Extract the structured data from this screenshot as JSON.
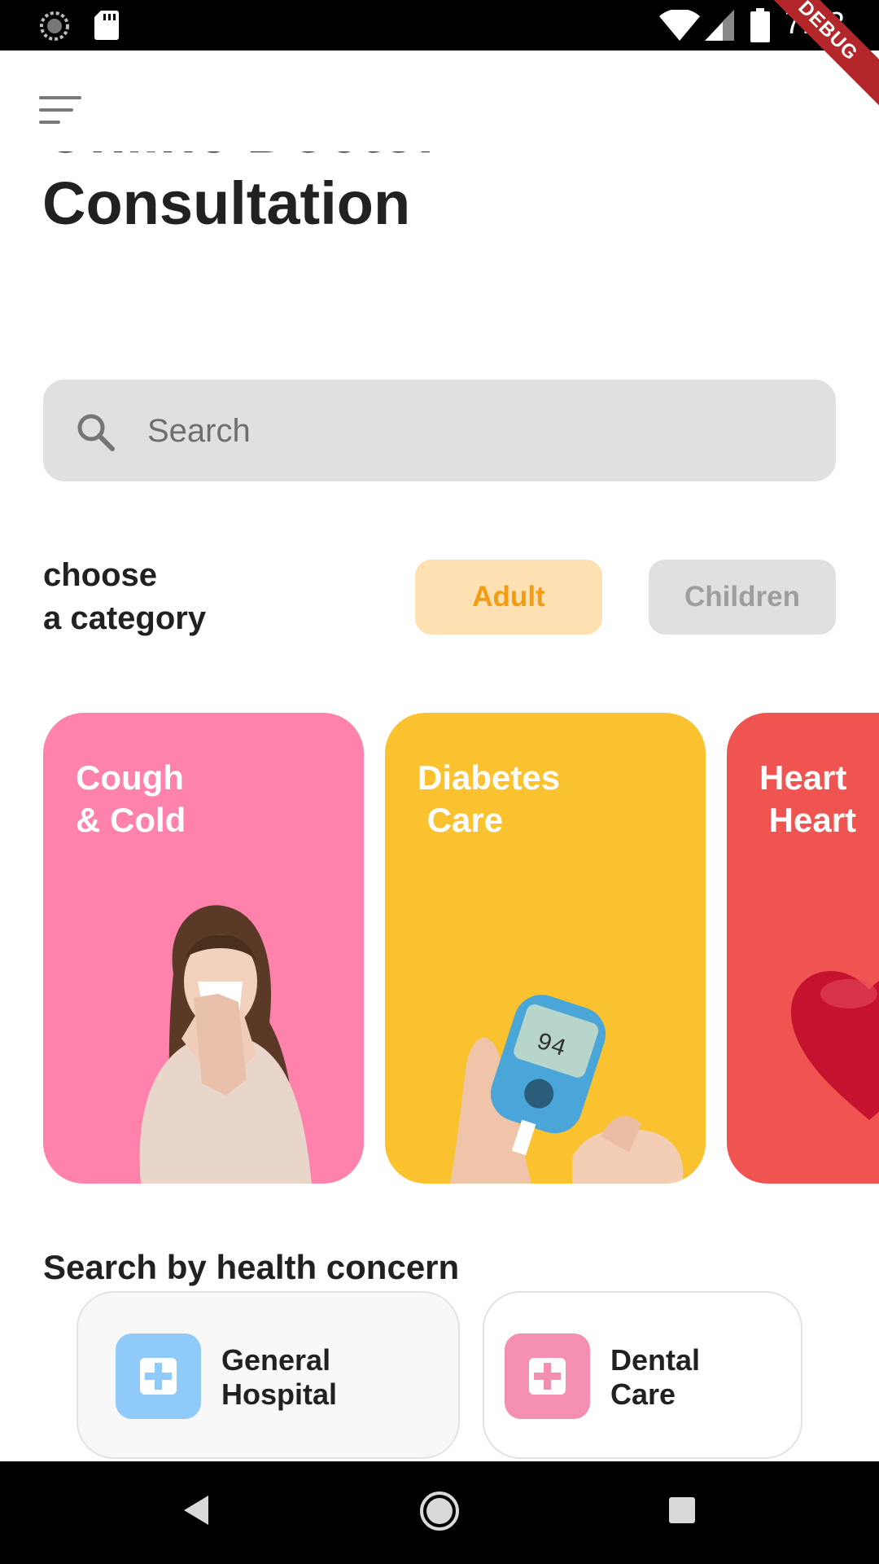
{
  "status_bar": {
    "time": "7:03",
    "debug_label": "DEBUG"
  },
  "header": {
    "menu_icon": "menu-icon",
    "title_line1": "Online Doctor",
    "title_line2": "Consultation"
  },
  "search": {
    "placeholder": "Search",
    "value": "",
    "icon": "search-icon"
  },
  "category": {
    "label_line1": "choose",
    "label_line2": "a category",
    "options": [
      {
        "label": "Adult",
        "selected": true,
        "bg": "#ffe0b2",
        "color": "#f39c12"
      },
      {
        "label": "Children",
        "selected": false,
        "bg": "#e0e0e0",
        "color": "#9e9e9e"
      }
    ]
  },
  "cards": [
    {
      "title": "Cough\n& Cold",
      "color": "#fe82ab",
      "illustration": "sneezing-woman"
    },
    {
      "title": "Diabetes\n Care",
      "color": "#f9c22e",
      "illustration": "glucose-meter"
    },
    {
      "title": "Heart\n Heart",
      "color": "#ef5450",
      "illustration": "heart"
    }
  ],
  "health_concern": {
    "title": "Search by health concern",
    "items": [
      {
        "label": "General\nHospital",
        "icon": "plus-cross-icon",
        "icon_color": "#90caf9"
      },
      {
        "label": "Dental\nCare",
        "icon": "plus-cross-icon",
        "icon_color": "#f48fb1"
      }
    ]
  }
}
